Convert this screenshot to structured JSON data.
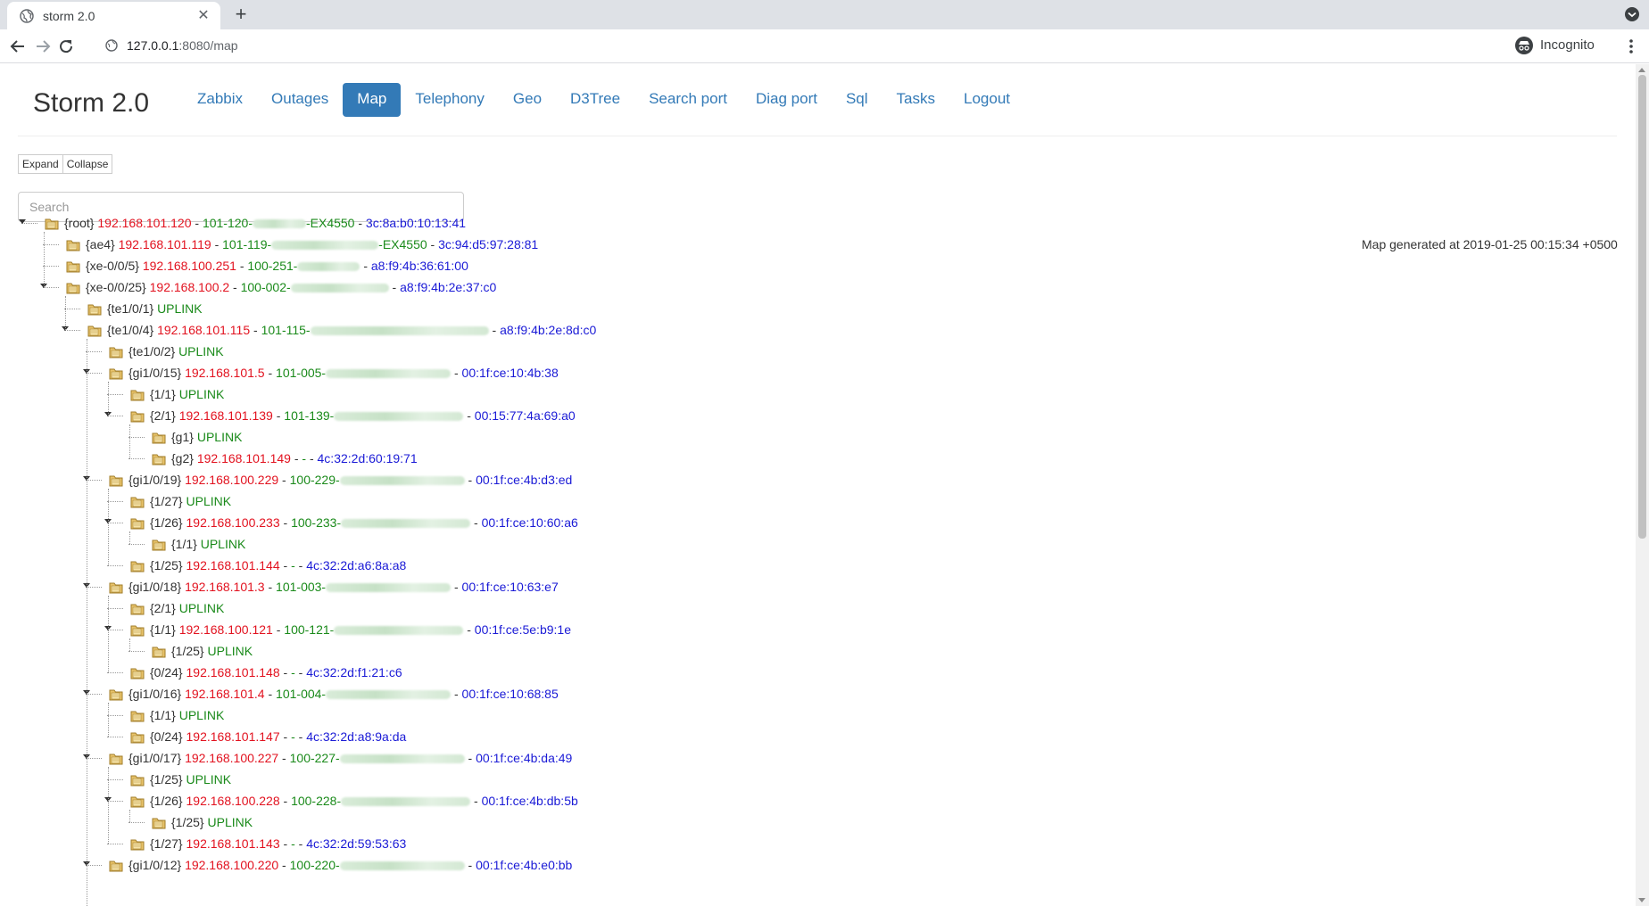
{
  "browser": {
    "tab_title": "storm 2.0",
    "url_host": "127.0.0.1",
    "url_rest": ":8080/map",
    "incognito_label": "Incognito"
  },
  "page": {
    "brand": "Storm 2.0",
    "nav": [
      {
        "label": "Zabbix",
        "active": false
      },
      {
        "label": "Outages",
        "active": false
      },
      {
        "label": "Map",
        "active": true
      },
      {
        "label": "Telephony",
        "active": false
      },
      {
        "label": "Geo",
        "active": false
      },
      {
        "label": "D3Tree",
        "active": false
      },
      {
        "label": "Search port",
        "active": false
      },
      {
        "label": "Diag port",
        "active": false
      },
      {
        "label": "Sql",
        "active": false
      },
      {
        "label": "Tasks",
        "active": false
      },
      {
        "label": "Logout",
        "active": false
      }
    ],
    "expand_label": "Expand",
    "collapse_label": "Collapse",
    "search_placeholder": "Search",
    "generated": "Map generated at 2019-01-25 00:15:34 +0500"
  },
  "tree": [
    {
      "depth": 0,
      "port": "{root}",
      "ip": "192.168.101.120",
      "dev_pre": "101-120-",
      "dev_post": "-EX4550",
      "mac": "3c:8a:b0:10:13:41",
      "expanded": true
    },
    {
      "depth": 1,
      "port": "{ae4}",
      "ip": "192.168.101.119",
      "dev_pre": "101-119-",
      "dev_post": "-EX4550",
      "mac": "3c:94:d5:97:28:81"
    },
    {
      "depth": 1,
      "port": "{xe-0/0/5}",
      "ip": "192.168.100.251",
      "dev_pre": "100-251-",
      "dev_post": "",
      "mac": "a8:f9:4b:36:61:00"
    },
    {
      "depth": 1,
      "port": "{xe-0/0/25}",
      "ip": "192.168.100.2",
      "dev_pre": "100-002-",
      "dev_post": "",
      "mac": "a8:f9:4b:2e:37:c0",
      "expanded": true
    },
    {
      "depth": 2,
      "port": "{te1/0/1}",
      "uplink": "UPLINK"
    },
    {
      "depth": 2,
      "port": "{te1/0/4}",
      "ip": "192.168.101.115",
      "dev_pre": "101-115-",
      "dev_post": "",
      "mac": "a8:f9:4b:2e:8d:c0",
      "expanded": true
    },
    {
      "depth": 3,
      "port": "{te1/0/2}",
      "uplink": "UPLINK"
    },
    {
      "depth": 3,
      "port": "{gi1/0/15}",
      "ip": "192.168.101.5",
      "dev_pre": "101-005-",
      "dev_post": "",
      "mac": "00:1f:ce:10:4b:38",
      "expanded": true
    },
    {
      "depth": 4,
      "port": "{1/1}",
      "uplink": "UPLINK"
    },
    {
      "depth": 4,
      "port": "{2/1}",
      "ip": "192.168.101.139",
      "dev_pre": "101-139-",
      "dev_post": "",
      "mac": "00:15:77:4a:69:a0",
      "expanded": true
    },
    {
      "depth": 5,
      "port": "{g1}",
      "uplink": "UPLINK"
    },
    {
      "depth": 5,
      "port": "{g2}",
      "ip": "192.168.101.149",
      "dev_pre": "-",
      "dev_post": "",
      "mac": "4c:32:2d:60:19:71",
      "noblur": true
    },
    {
      "depth": 3,
      "port": "{gi1/0/19}",
      "ip": "192.168.100.229",
      "dev_pre": "100-229-",
      "dev_post": "",
      "mac": "00:1f:ce:4b:d3:ed",
      "expanded": true
    },
    {
      "depth": 4,
      "port": "{1/27}",
      "uplink": "UPLINK"
    },
    {
      "depth": 4,
      "port": "{1/26}",
      "ip": "192.168.100.233",
      "dev_pre": "100-233-",
      "dev_post": "",
      "mac": "00:1f:ce:10:60:a6",
      "expanded": true
    },
    {
      "depth": 5,
      "port": "{1/1}",
      "uplink": "UPLINK"
    },
    {
      "depth": 4,
      "port": "{1/25}",
      "ip": "192.168.101.144",
      "dev_pre": "-",
      "dev_post": "",
      "mac": "4c:32:2d:a6:8a:a8",
      "noblur": true
    },
    {
      "depth": 3,
      "port": "{gi1/0/18}",
      "ip": "192.168.101.3",
      "dev_pre": "101-003-",
      "dev_post": "",
      "mac": "00:1f:ce:10:63:e7",
      "expanded": true
    },
    {
      "depth": 4,
      "port": "{2/1}",
      "uplink": "UPLINK"
    },
    {
      "depth": 4,
      "port": "{1/1}",
      "ip": "192.168.100.121",
      "dev_pre": "100-121-",
      "dev_post": "",
      "mac": "00:1f:ce:5e:b9:1e",
      "expanded": true
    },
    {
      "depth": 5,
      "port": "{1/25}",
      "uplink": "UPLINK"
    },
    {
      "depth": 4,
      "port": "{0/24}",
      "ip": "192.168.101.148",
      "dev_pre": "-",
      "dev_post": "",
      "mac": "4c:32:2d:f1:21:c6",
      "noblur": true
    },
    {
      "depth": 3,
      "port": "{gi1/0/16}",
      "ip": "192.168.101.4",
      "dev_pre": "101-004-",
      "dev_post": "",
      "mac": "00:1f:ce:10:68:85",
      "expanded": true
    },
    {
      "depth": 4,
      "port": "{1/1}",
      "uplink": "UPLINK"
    },
    {
      "depth": 4,
      "port": "{0/24}",
      "ip": "192.168.101.147",
      "dev_pre": "-",
      "dev_post": "",
      "mac": "4c:32:2d:a8:9a:da",
      "noblur": true
    },
    {
      "depth": 3,
      "port": "{gi1/0/17}",
      "ip": "192.168.100.227",
      "dev_pre": "100-227-",
      "dev_post": "",
      "mac": "00:1f:ce:4b:da:49",
      "expanded": true
    },
    {
      "depth": 4,
      "port": "{1/25}",
      "uplink": "UPLINK"
    },
    {
      "depth": 4,
      "port": "{1/26}",
      "ip": "192.168.100.228",
      "dev_pre": "100-228-",
      "dev_post": "",
      "mac": "00:1f:ce:4b:db:5b",
      "expanded": true
    },
    {
      "depth": 5,
      "port": "{1/25}",
      "uplink": "UPLINK"
    },
    {
      "depth": 4,
      "port": "{1/27}",
      "ip": "192.168.101.143",
      "dev_pre": "-",
      "dev_post": "",
      "mac": "4c:32:2d:59:53:63",
      "noblur": true
    },
    {
      "depth": 3,
      "port": "{gi1/0/12}",
      "ip": "192.168.100.220",
      "dev_pre": "100-220-",
      "dev_post": "",
      "mac": "00:1f:ce:4b:e0:bb",
      "expanded": true
    }
  ]
}
